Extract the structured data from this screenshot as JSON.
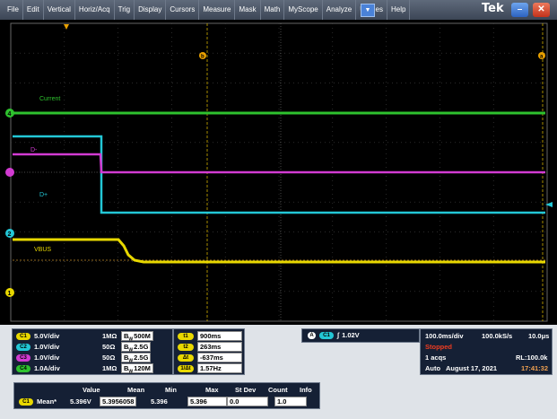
{
  "menu": {
    "items": [
      "File",
      "Edit",
      "Vertical",
      "Horiz/Acq",
      "Trig",
      "Display",
      "Cursors",
      "Measure",
      "Mask",
      "Math",
      "MyScope",
      "Analyze",
      "Utilities",
      "Help"
    ],
    "logo": "Tek"
  },
  "screen": {
    "labels": {
      "current": "Current",
      "dminus": "D-",
      "dplus": "D+",
      "vbus": "VBUS"
    },
    "markers": {
      "ch4": "4",
      "ch2": "2",
      "ch1": "1",
      "ref_a": "a",
      "ref_b": "b"
    }
  },
  "channels": [
    {
      "id": "C1",
      "scale": "5.0V/div",
      "imp": "1MΩ",
      "bw": "500M",
      "color": "#e8d800"
    },
    {
      "id": "C2",
      "scale": "1.0V/div",
      "imp": "50Ω",
      "bw": "2.5G",
      "color": "#23c7d6"
    },
    {
      "id": "C3",
      "scale": "1.0V/div",
      "imp": "50Ω",
      "bw": "2.5G",
      "color": "#d23bd2"
    },
    {
      "id": "C4",
      "scale": "1.0A/div",
      "imp": "1MΩ",
      "bw": "120M",
      "color": "#2ec22e"
    }
  ],
  "bw_prefix": "B",
  "bw_sub": "W",
  "cursors": [
    {
      "label": "t1",
      "value": "900ms"
    },
    {
      "label": "t2",
      "value": "263ms"
    },
    {
      "label": "Δt",
      "value": "-637ms"
    },
    {
      "label": "1/Δt",
      "value": "1.57Hz"
    }
  ],
  "trigger": {
    "source_letter": "A",
    "source": "C1",
    "level": "1.02V",
    "slope_symbol": "∫"
  },
  "timebase": {
    "horiz": "100.0ms/div",
    "rate": "100.0kS/s",
    "res": "10.0μs",
    "state": "Stopped",
    "acqs": "1 acqs",
    "rl": "RL:100.0k",
    "mode": "Auto",
    "date": "August 17, 2021",
    "time": "17:41:32"
  },
  "measurement": {
    "headers": [
      "Value",
      "Mean",
      "Min",
      "Max",
      "St Dev",
      "Count",
      "Info"
    ],
    "row": {
      "ch": "C1",
      "name": "Mean*",
      "value": "5.396V",
      "mean": "5.3956058",
      "min": "5.396",
      "max": "5.396",
      "stdev": "0.0",
      "count": "1.0",
      "info": ""
    }
  }
}
